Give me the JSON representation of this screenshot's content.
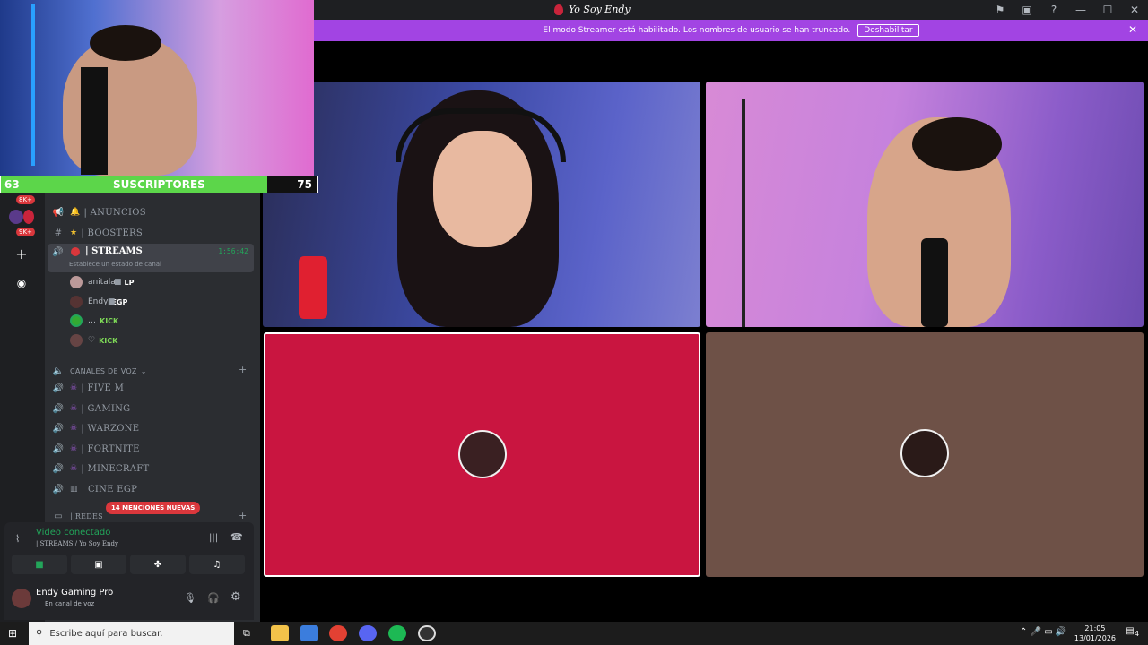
{
  "window": {
    "title": "Yo Soy Endy",
    "icons": [
      "flag-icon",
      "screen-icon",
      "help-icon",
      "minimize-icon",
      "maximize-icon",
      "close-icon"
    ]
  },
  "banner": {
    "message": "El modo Streamer está habilitado. Los nombres de usuario se han truncado.",
    "button": "Deshabilitar"
  },
  "overlay": {
    "subs_current": "63",
    "subs_label": "SUSCRIPTORES",
    "subs_goal": "75",
    "progress": 0.84
  },
  "servers": {
    "badges": [
      "8K+",
      "9K+"
    ]
  },
  "channels": {
    "text": [
      {
        "emoji": "🔔",
        "name": "| ANUNCIOS"
      },
      {
        "emoji": "★",
        "name": "| BOOSTERS"
      }
    ],
    "streams": {
      "name": "| STREAMS",
      "time": "1:56:42",
      "status": "Establece un estado de canal"
    },
    "members": [
      {
        "name": "anitalau",
        "tag": "LP"
      },
      {
        "name": "Endy",
        "tag": "EGP"
      },
      {
        "name": "…",
        "tag": "KICK"
      },
      {
        "name": "♡",
        "tag": "KICK"
      }
    ],
    "voice_category": "CANALES DE VOZ",
    "voice": [
      {
        "name": "| FIVE M"
      },
      {
        "name": "|  GAMING"
      },
      {
        "name": "| WARZONE"
      },
      {
        "name": "| FORTNITE"
      },
      {
        "name": "| MINECRAFT"
      },
      {
        "name": "| CINE EGP"
      }
    ],
    "redes": "| REDES",
    "mentions": "14 MENCIONES NUEVAS"
  },
  "voice_panel": {
    "status": "Video conectado",
    "channel": "| STREAMS / Yo Soy Endy"
  },
  "user": {
    "name": "Endy Gaming Pro",
    "status": "En canal de voz"
  },
  "taskbar": {
    "search_placeholder": "Escribe aquí para buscar.",
    "time": "21:05",
    "date": "13/01/2026",
    "notifications": "4"
  }
}
